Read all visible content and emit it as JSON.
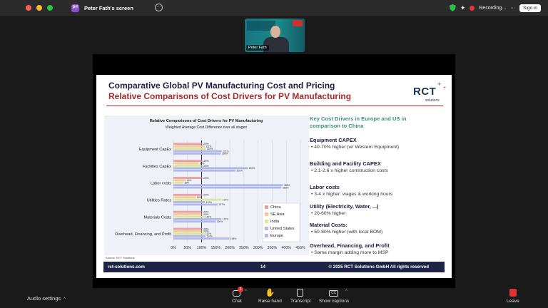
{
  "window": {
    "tab_title": "Peter Fath's screen",
    "tab_badge": "PF",
    "traffic_colors": [
      "#ff5f57",
      "#febc2e",
      "#28c840"
    ],
    "recording_label": "Recording...",
    "sign_in_label": "Sign in"
  },
  "participant": {
    "name": "Peter Fath"
  },
  "slide": {
    "title": "Comparative Global PV Manufacturing Cost and Pricing",
    "subtitle": "Relative Comparisons of Cost Drivers for PV Manufacturing",
    "logo_text": "RCT",
    "logo_sub": "solutions",
    "source": "Source: RCT Solutions",
    "key_title": "Key Cost Drivers in Europe and US in comparison to China",
    "drivers": [
      {
        "heading": "Equipment CAPEX",
        "bullet": "• 40-70% higher (w/ Western Equipment)"
      },
      {
        "heading": "Building and Facility CAPEX",
        "bullet": "• 2.1-2.6 x higher construction costs"
      },
      {
        "heading": "Labor costs",
        "bullet": "• 3-4 x higher: wages & working hours"
      },
      {
        "heading": "Utility (Electricity, Water, ...)",
        "bullet": "• 20-60% higher"
      },
      {
        "heading": "Material Costs:",
        "bullet": "• 50-80% higher (with local BOM)"
      },
      {
        "heading": "Overhead, Financing, and Profit",
        "bullet": "• Same margin adding more to MSP"
      }
    ],
    "footer_left": "rct-solutions.com",
    "page_number": "14",
    "footer_right": "© 2025 RCT Solutions GmbH All rights reserved"
  },
  "chart_data": {
    "type": "bar",
    "orientation": "horizontal",
    "title": "Relative Comparisons of Cost Drivers for PV Manufacturing",
    "subtitle": "Weighted Average Cost Difference over all stages",
    "categories": [
      "Equipment CapEx",
      "Facilities CapEx",
      "Labor costs",
      "Utilities Rates",
      "Materials Costs",
      "Overhead, Financing, and Profit"
    ],
    "series": [
      {
        "name": "China",
        "color": "#e8a0a0",
        "values": [
          100,
          100,
          100,
          100,
          100,
          100
        ]
      },
      {
        "name": "SE Asia",
        "color": "#f5c99a",
        "values": [
          111,
          89,
          44,
          80,
          100,
          100
        ]
      },
      {
        "name": "India",
        "color": "#d9e89a",
        "values": [
          115,
          100,
          35,
          170,
          110,
          110
        ]
      },
      {
        "name": "United States",
        "color": "#b3b8e6",
        "values": [
          171,
          264,
          388,
          112,
          170,
          114
        ]
      },
      {
        "name": "Europe",
        "color": "#b3b8e6",
        "values": [
          168,
          220,
          383,
          157,
          150,
          198
        ]
      }
    ],
    "data_labels": [
      [
        "100%",
        "111%",
        "115%",
        "171%",
        "168%"
      ],
      [
        "100%",
        "89%",
        "100%",
        "264%",
        "220%"
      ],
      [
        "100%",
        "44%",
        "35%",
        "388%",
        "383%"
      ],
      [
        "100%",
        "80%",
        "170%",
        "112%",
        "157%"
      ],
      [
        "100%",
        "100%",
        "110%",
        "170%",
        "150%"
      ],
      [
        "100%",
        "100%",
        "110%",
        "114%",
        "198%"
      ]
    ],
    "x_ticks": [
      "0%",
      "50%",
      "100%",
      "150%",
      "200%",
      "250%",
      "300%",
      "350%",
      "400%",
      "450%"
    ],
    "xlim": [
      0,
      450
    ],
    "reference_line": 100,
    "grid": true,
    "legend_position": "bottom-right"
  },
  "controls": {
    "audio_settings": "Audio settings",
    "chat": "Chat",
    "chat_badge": "3",
    "raise_hand": "Raise hand",
    "transcript": "Transcript",
    "captions": "Show captions",
    "cc_glyph": "CC",
    "leave": "Leave"
  }
}
